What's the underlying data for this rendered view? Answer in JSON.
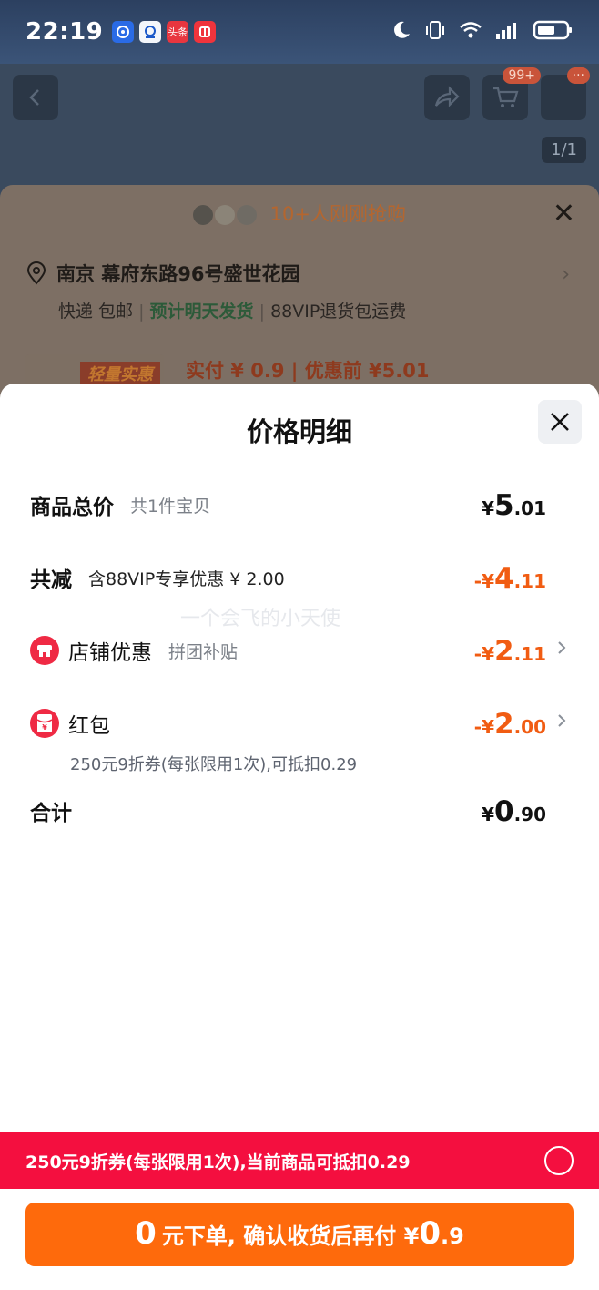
{
  "status_bar": {
    "time": "22:19",
    "app_icons": [
      "app-icon-blue",
      "app-icon-bank",
      "app-icon-toutiao",
      "app-icon-red"
    ],
    "app_icon_labels": [
      "",
      "",
      "头条",
      ""
    ],
    "system_icons": [
      "moon-icon",
      "vibrate-icon",
      "wifi-icon",
      "signal-icon",
      "battery-icon"
    ]
  },
  "background_page": {
    "cart_badge": "99+",
    "more_badge": "···",
    "image_counter": "1/1",
    "recent_buyers": "10+人刚刚抢购",
    "address": "南京 幕府东路96号盛世花园",
    "delivery": {
      "express": "快递 包邮",
      "eta": "预计明天发货",
      "vip_return": "88VIP退货包运费"
    },
    "product_thumb_tag": "轻量实惠",
    "price_summary": "实付 ¥ 0.9 | 优惠前 ¥5.01"
  },
  "sheet": {
    "title": "价格明细",
    "rows": {
      "total": {
        "label": "商品总价",
        "sub": "共1件宝贝",
        "currency": "¥",
        "int": "5",
        "dec": ".01"
      },
      "discount": {
        "label": "共减",
        "sub": "含88VIP专享优惠 ¥ 2.00",
        "currency": "-¥",
        "int": "4",
        "dec": ".11"
      },
      "shop": {
        "label": "店铺优惠",
        "sub": "拼团补贴",
        "currency": "-¥",
        "int": "2",
        "dec": ".11"
      },
      "redpacket": {
        "label": "红包",
        "sub": "250元9折券(每张限用1次),可抵扣0.29",
        "currency": "-¥",
        "int": "2",
        "dec": ".00"
      },
      "sum": {
        "label": "合计",
        "currency": "¥",
        "int": "0",
        "dec": ".90"
      }
    },
    "watermark": "一个会飞的小天使",
    "coupon_bar": "250元9折券(每张限用1次),当前商品可抵扣0.29",
    "cta": {
      "lead": "0",
      "text": "元下单, 确认收货后再付 ¥",
      "amount": "0",
      "dec": ".9"
    }
  },
  "colors": {
    "accent_orange": "#f15c12",
    "cta_orange": "#fe6a0c",
    "coupon_red": "#f40f3f",
    "icon_red": "#ef2a44"
  }
}
